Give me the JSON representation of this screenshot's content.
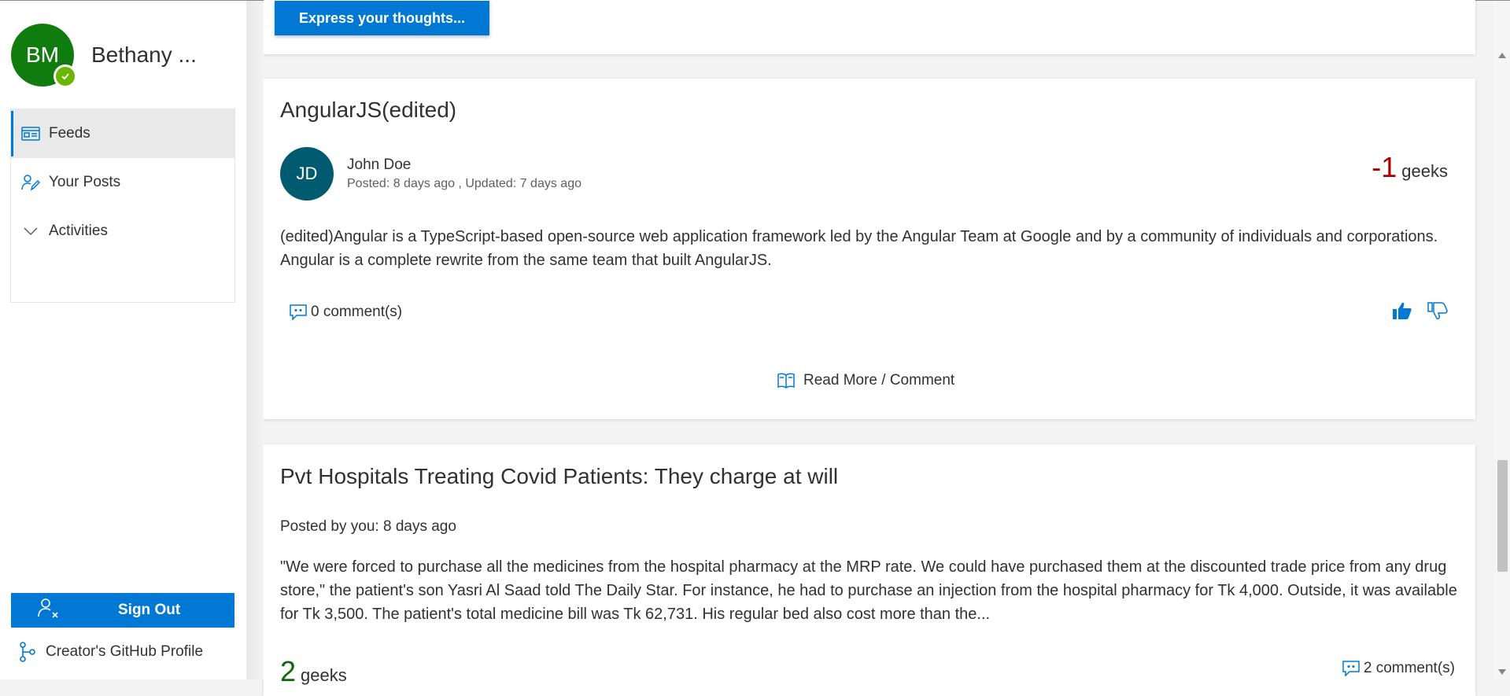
{
  "user": {
    "initials": "BM",
    "name": "Bethany ..."
  },
  "nav": {
    "items": [
      {
        "label": "Feeds",
        "icon": "feed-icon",
        "active": true
      },
      {
        "label": "Your Posts",
        "icon": "edit-person-icon",
        "active": false
      },
      {
        "label": "Activities",
        "icon": "chevron-down-icon",
        "active": false
      }
    ],
    "signout_label": "Sign Out",
    "github_label": "Creator's GitHub Profile"
  },
  "compose": {
    "button_label": "Express your thoughts..."
  },
  "posts": [
    {
      "title": "AngularJS(edited)",
      "author_initials": "JD",
      "author_name": "John Doe",
      "meta": "Posted: 8 days ago , Updated: 7 days ago",
      "score": "-1",
      "score_unit": "geeks",
      "body": "(edited)Angular is a TypeScript-based open-source web application framework led by the Angular Team at Google and by a community of individuals and corporations. Angular is a complete rewrite from the same team that built AngularJS.",
      "comments": "0 comment(s)",
      "read_more": "Read More / Comment"
    },
    {
      "title": "Pvt Hospitals Treating Covid Patients: They charge at will",
      "meta": "Posted by you: 8 days ago",
      "body": "\"We were forced to purchase all the medicines from the hospital pharmacy at the MRP rate. We could have purchased them at the discounted trade price from any drug store,\" the patient's son Yasri Al Saad told The Daily Star. For instance, he had to purchase an injection from the hospital pharmacy for Tk 4,000. Outside, it was available for Tk 3,500. The patient's total medicine bill was Tk 62,731. His regular bed also cost more than the...",
      "score": "2",
      "score_unit": "geeks",
      "comments": "2 comment(s)"
    }
  ],
  "colors": {
    "accent": "#0078d4",
    "avatar_user": "#107c10",
    "avatar_author": "#005b70",
    "negative": "#a80000",
    "positive": "#0b6a0b",
    "presence": "#6bb700"
  }
}
